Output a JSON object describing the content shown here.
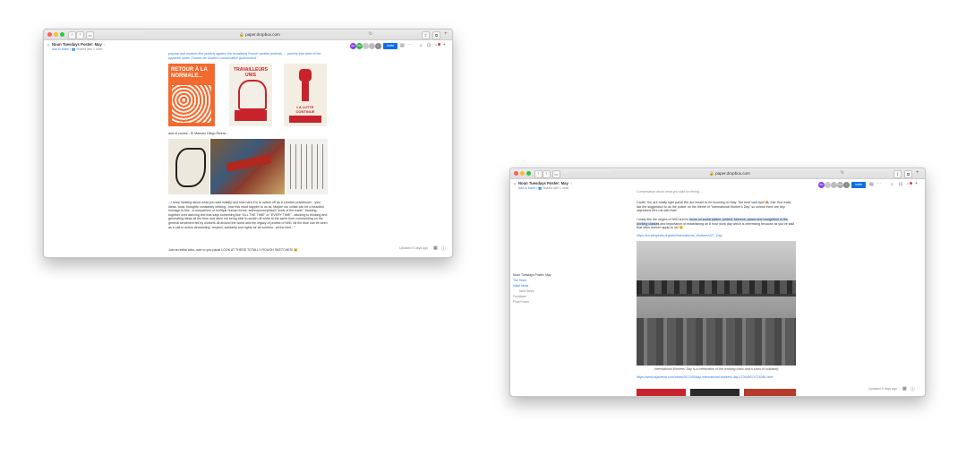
{
  "browser": {
    "url": "paper.dropbox.com",
    "reload_icon": "reload-icon",
    "back_icon": "chevron-left-icon",
    "forward_icon": "chevron-right-icon"
  },
  "doc": {
    "title": "Noun Tuesdays Poster: May",
    "star": "☆",
    "add_to_folder": "Add to folder",
    "shared_with": "Shared with 1 other",
    "invite_label": "Invite",
    "updated": "Updated 5 days ago",
    "avatars": [
      "SR",
      "PM",
      "",
      "",
      "+"
    ]
  },
  "left": {
    "top_quote": "popular and workers first publicly against the escalating French student protests. ... poverty that were of the apparent under Charles de Gaulle's conservative government.\"",
    "posters": [
      "RETOUR À LA NORMALE...",
      "TRAVAILLEURS UNIS",
      "LA LUTTE CONTINUE"
    ],
    "caption2": "and of course - El Maestro Diego Rivera...",
    "paragraph": "...I keep thinking about what you said initially and how hard it is to switch off as a creative practitioner - your ideas, tools, thoughts constantly orbiting...how this must happen to us all. Maybe our collab can be a beautiful homage to this...a comparison of multiple human forms, anthropomorphised \"tools of the trade,\" banding together over dancing text that says something like \"ALL THE TIME\" or \"EVERY TIME\"...alluding to thinking and generating ideas all the time and often not being able to switch off while at the same time commenting on the general sentiment felt by workers all around the world and the legacy of protest of IWD. All the time can be seen as a call to action demanding \"respect, solidarity and rights for all workers...all the time...\"",
    "last_line": "Just an initial idea, over to you panal LOOK AT THESE TOTALLY ROUGH SKETCHES! 😄"
  },
  "right": {
    "top_cut": "Conversation about what you said on timing..., ",
    "paragraph1": "Carlin! You are totally right panal We are meant to be focusing on May. The brief said April 🙈 Zak. But really like the suggestion to do the poster on the theme of \"International Worker's Day\" so unless there are any objections let's roll with that!",
    "paragraph2_pre": "I really like the origins of IWD and its ",
    "paragraph2_hl": "focus on social justice, protest, fairness, peace and recognition of the working classes",
    "paragraph2_post": " and importance of establishing an 8 hour work day which is interesting because as you've said that often doesn't apply to us! 😉",
    "link1": "https://en.wikipedia.org/wiki/International_Workers%27_Day",
    "photo_caption": "International Workers' Day is a celebration of the working class and a show of solidarity",
    "link2": "https://www.aljazeera.com/news/2017/05/day-international-workers-day-170428074724381.html",
    "sidebar": {
      "title": "Noun Tuesdays Poster: May",
      "items": [
        "The Team",
        "Initial Ideas",
        "Next Steps",
        "Feedback",
        "Final Poster"
      ]
    }
  },
  "colors": {
    "accent": "#0d6ee8",
    "link": "#2d7ee0",
    "poster_orange": "#e8572a",
    "poster_red": "#c8232c"
  }
}
